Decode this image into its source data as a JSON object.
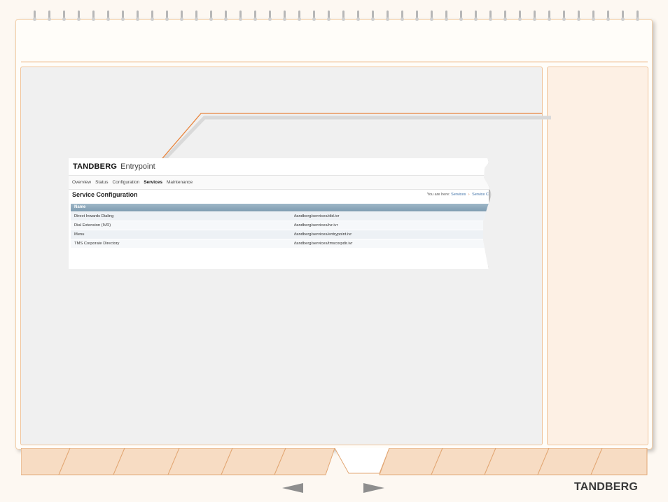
{
  "screenshot": {
    "brand": "TANDBERG",
    "product": "Entrypoint",
    "nav_items": [
      "Overview",
      "Status",
      "Configuration",
      "Services",
      "Maintenance"
    ],
    "active_nav": "Services",
    "page_title": "Service Configuration",
    "breadcrumb": {
      "prefix": "You are here:",
      "link1": "Services",
      "separator": "›",
      "link2": "Service C"
    },
    "table": {
      "header": "Name",
      "rows": [
        {
          "name": "Direct Inwards Dialing",
          "path": "/tandberg/services/did.ivr"
        },
        {
          "name": "Dial Extension (IVR)",
          "path": "/tandberg/services/ivr.ivr"
        },
        {
          "name": "Menu",
          "path": "/tandberg/services/entrypoint.ivr"
        },
        {
          "name": "TMS Corporate Directory",
          "path": "/tandberg/services/tmscorpdir.ivr"
        }
      ]
    }
  },
  "footer": {
    "logo": "TANDBERG"
  },
  "colors": {
    "accent": "#e8843c",
    "tab_fill": "#f7dcc3",
    "panel_bg": "#f0f0f0",
    "side_bg": "#fdf0e4"
  }
}
